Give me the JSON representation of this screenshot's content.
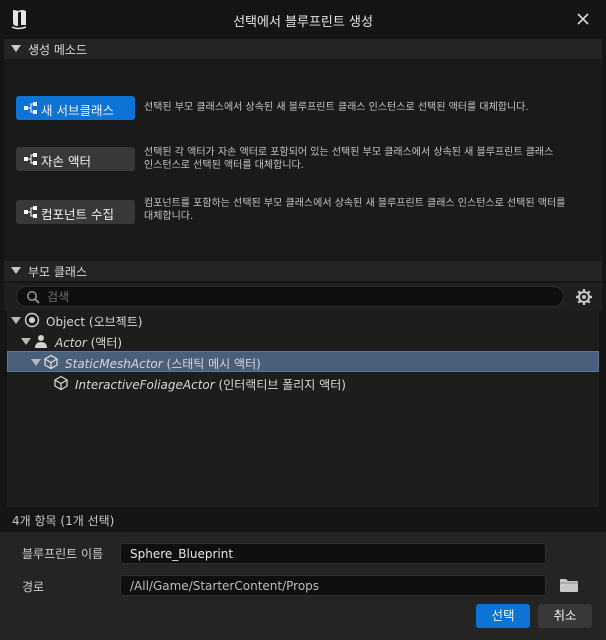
{
  "window": {
    "title": "선택에서 블루프린트 생성"
  },
  "creation_method": {
    "header": "생성 메소드",
    "options": [
      {
        "label": "새 서브클래스",
        "desc_lines": [
          "선택된 부모 클래스에서 상속된 새 블루프린트 클래스 인스턴스로 선택된 액터를 대체합니다."
        ],
        "selected": true
      },
      {
        "label": "자손 액터",
        "desc_lines": [
          "선택된 각 액터가 자손 액터로 포함되어 있는 선택된 부모 클래스에서 상속된 새 블루프린트 클래스",
          "인스턴스로 선택된 액터를 대체합니다."
        ],
        "selected": false
      },
      {
        "label": "컴포넌트 수집",
        "desc_lines": [
          "컴포넌트를 포함하는 선택된 부모 클래스에서 상속된 새 블루프린트 클래스 인스턴스로 선택된 액터를",
          "대체합니다."
        ],
        "selected": false
      }
    ]
  },
  "parent_class": {
    "header": "부모 클래스",
    "search": {
      "placeholder": "검색",
      "value": ""
    },
    "tree": [
      {
        "name": "Object",
        "suffix": " (오브젝트)",
        "italic": false,
        "icon": "object-icon",
        "expanded": true,
        "selected": false
      },
      {
        "name": "Actor",
        "suffix": " (액터)",
        "italic": true,
        "icon": "actor-icon",
        "expanded": true,
        "selected": false
      },
      {
        "name": "StaticMeshActor",
        "suffix": " (스태틱 메시 액터)",
        "italic": true,
        "icon": "static-mesh-icon",
        "expanded": true,
        "selected": true
      },
      {
        "name": "InteractiveFoliageActor",
        "suffix": " (인터랙티브 폴리지 액터)",
        "italic": true,
        "icon": "static-mesh-icon",
        "expanded": false,
        "selected": false
      }
    ],
    "status": "4개 항목 (1개 선택)"
  },
  "form": {
    "name_label": "블루프린트 이름",
    "name_value": "Sphere_Blueprint",
    "path_label": "경로",
    "path_value": "/All/Game/StarterContent/Props"
  },
  "buttons": {
    "ok": "선택",
    "cancel": "취소"
  },
  "colors": {
    "accent": "#0e73d6",
    "selection": "#4a5f7a",
    "background": "#151515",
    "panel": "#1a1a1a"
  }
}
